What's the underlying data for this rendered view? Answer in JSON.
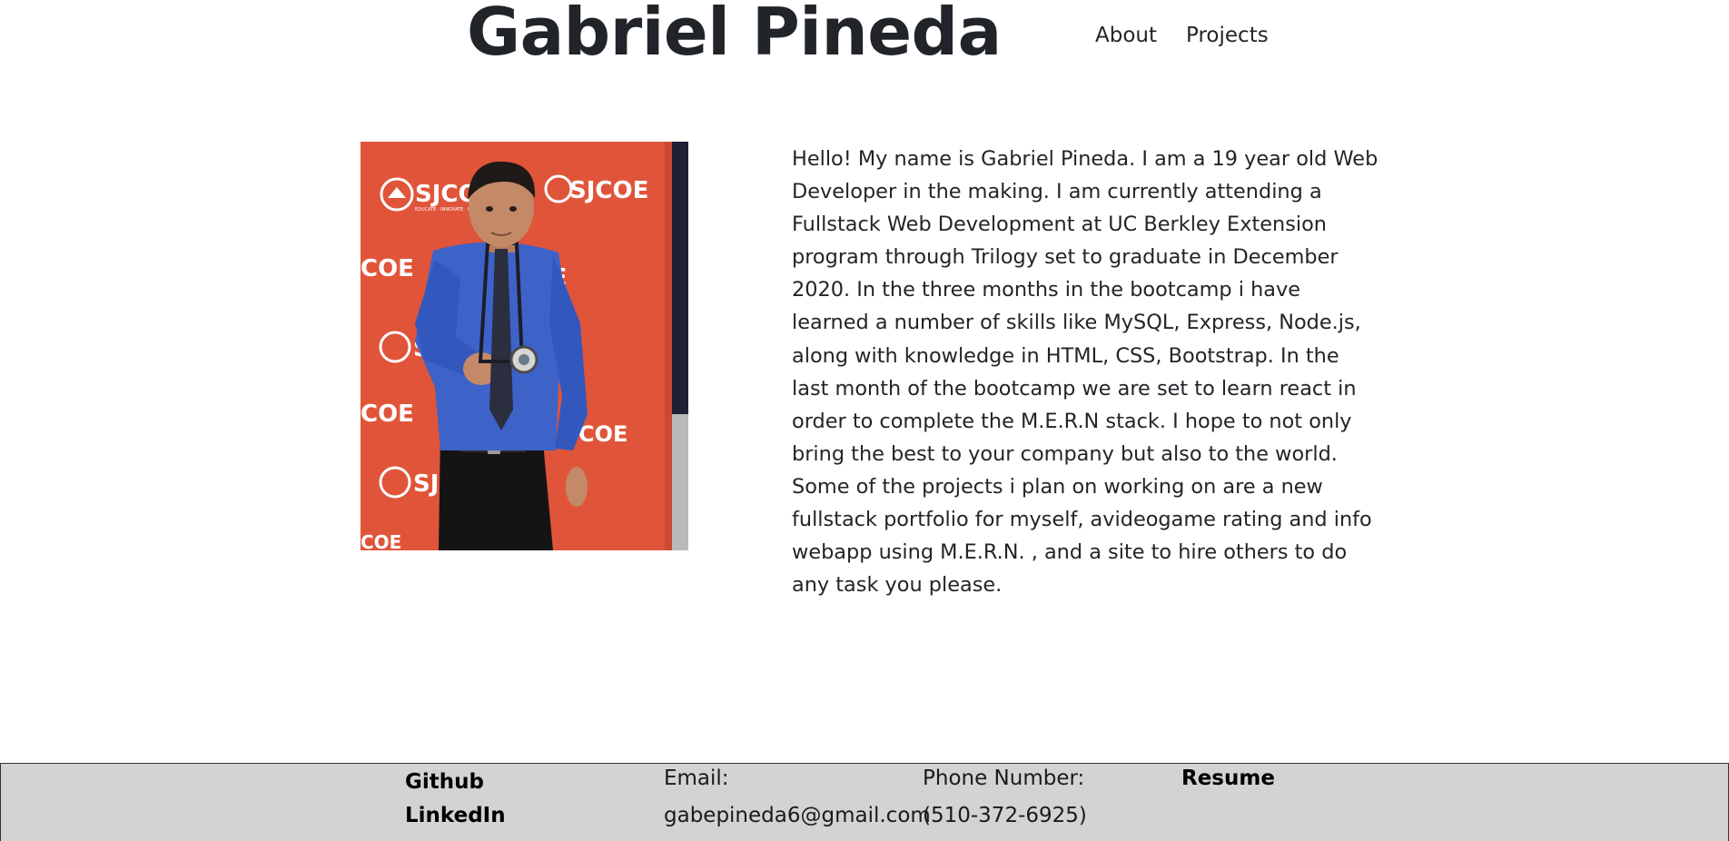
{
  "header": {
    "title": "Gabriel Pineda",
    "nav": [
      {
        "label": "About"
      },
      {
        "label": "Projects"
      }
    ]
  },
  "profile": {
    "photo_banner_text": "SJCOE",
    "photo_banner_tagline": "EDUCATE · INNOVATE · INSPIRE",
    "bio": "Hello! My name is Gabriel Pineda. I am a 19 year old Web Developer in the making. I am currently attending a Fullstack Web Development at UC Berkley Extension program through Trilogy set to graduate in December 2020. In the three months in the bootcamp i have learned a number of skills like MySQL, Express, Node.js, along with knowledge in HTML, CSS, Bootstrap. In the last month of the bootcamp we are set to learn react in order to complete the M.E.R.N stack. I hope to not only bring the best to your company but also to the world. Some of the projects i plan on working on are a new fullstack portfolio for myself, avideogame rating and info webapp using M.E.R.N. , and a site to hire others to do any task you please."
  },
  "footer": {
    "github_label": "Github",
    "linkedin_label": "LinkedIn",
    "email_heading": "Email:",
    "email_value": "gabepineda6@gmail.com",
    "phone_heading": "Phone Number:",
    "phone_value": "(510-372-6925)",
    "resume_label": "Resume"
  },
  "colors": {
    "banner_red": "#e0553a",
    "shirt_blue": "#3d63c9",
    "footer_bg": "#d3d3d3",
    "text": "#212529"
  }
}
